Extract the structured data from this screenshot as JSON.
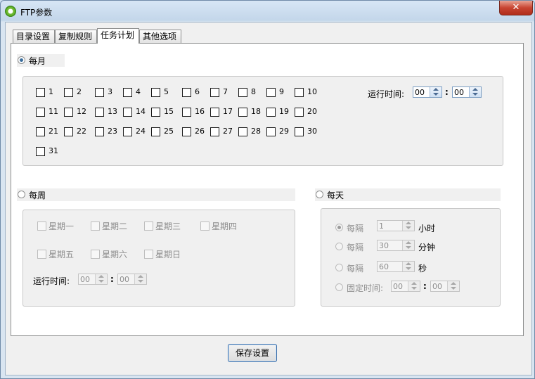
{
  "window": {
    "title": "FTP参数",
    "close_glyph": "✕"
  },
  "tabs": [
    "目录设置",
    "复制规则",
    "任务计划",
    "其他选项"
  ],
  "monthly": {
    "label": "每月",
    "selected": true,
    "days": [
      "1",
      "2",
      "3",
      "4",
      "5",
      "6",
      "7",
      "8",
      "9",
      "10",
      "11",
      "12",
      "13",
      "14",
      "15",
      "16",
      "17",
      "18",
      "19",
      "20",
      "21",
      "22",
      "23",
      "24",
      "25",
      "26",
      "27",
      "28",
      "29",
      "30",
      "31"
    ],
    "run_time_label": "运行时间:",
    "hour": "00",
    "minute": "00",
    "colon": ":"
  },
  "weekly": {
    "label": "每周",
    "selected": false,
    "days": [
      "星期一",
      "星期二",
      "星期三",
      "星期四",
      "星期五",
      "星期六",
      "星期日"
    ],
    "run_time_label": "运行时间:",
    "hour": "00",
    "minute": "00",
    "colon": ":"
  },
  "daily": {
    "label": "每天",
    "selected": false,
    "rows": [
      {
        "label": "每隔",
        "value": "1",
        "unit": "小时",
        "selected": true
      },
      {
        "label": "每隔",
        "value": "30",
        "unit": "分钟",
        "selected": false
      },
      {
        "label": "每隔",
        "value": "60",
        "unit": "秒",
        "selected": false
      }
    ],
    "fixed_time_label": "固定时间:",
    "fixed_hour": "00",
    "fixed_minute": "00",
    "colon": ":"
  },
  "save_button": "保存设置"
}
